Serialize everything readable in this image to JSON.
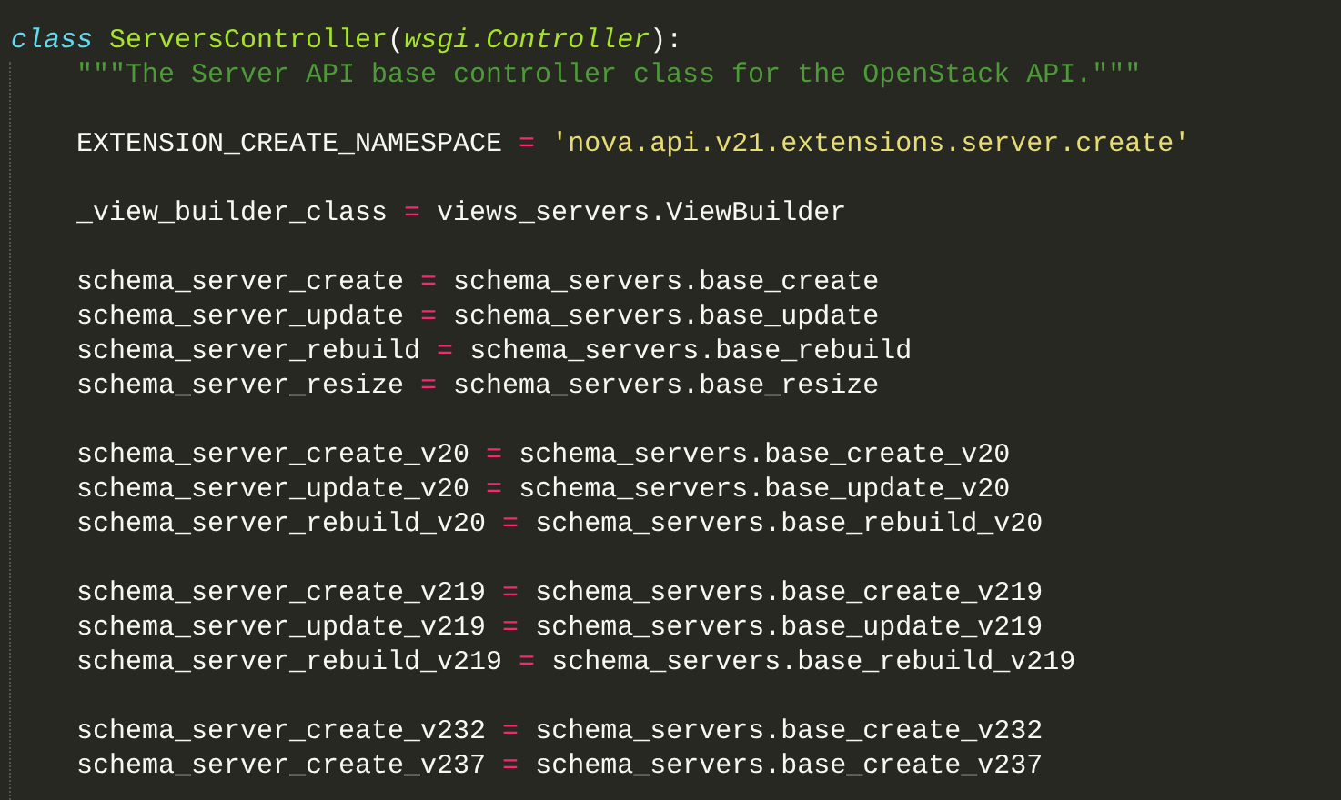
{
  "editor": {
    "class_line": [
      {
        "kind": "keyword",
        "text": "class"
      },
      {
        "kind": "name",
        "text": " ServersController"
      },
      {
        "kind": "plain",
        "text": "("
      },
      {
        "kind": "base",
        "text": "wsgi.Controller"
      },
      {
        "kind": "plain",
        "text": "):"
      }
    ],
    "body_blocks": [
      [
        [
          {
            "kind": "docstring",
            "text": "\"\"\"The Server API base controller class for the OpenStack API.\"\"\""
          }
        ]
      ],
      [
        [
          {
            "kind": "plain",
            "text": "EXTENSION_CREATE_NAMESPACE "
          },
          {
            "kind": "operator",
            "text": "="
          },
          {
            "kind": "string",
            "text": " 'nova.api.v21.extensions.server.create'"
          }
        ]
      ],
      [
        [
          {
            "kind": "plain",
            "text": "_view_builder_class "
          },
          {
            "kind": "operator",
            "text": "="
          },
          {
            "kind": "plain",
            "text": " views_servers.ViewBuilder"
          }
        ]
      ],
      [
        [
          {
            "kind": "plain",
            "text": "schema_server_create "
          },
          {
            "kind": "operator",
            "text": "="
          },
          {
            "kind": "plain",
            "text": " schema_servers.base_create"
          }
        ],
        [
          {
            "kind": "plain",
            "text": "schema_server_update "
          },
          {
            "kind": "operator",
            "text": "="
          },
          {
            "kind": "plain",
            "text": " schema_servers.base_update"
          }
        ],
        [
          {
            "kind": "plain",
            "text": "schema_server_rebuild "
          },
          {
            "kind": "operator",
            "text": "="
          },
          {
            "kind": "plain",
            "text": " schema_servers.base_rebuild"
          }
        ],
        [
          {
            "kind": "plain",
            "text": "schema_server_resize "
          },
          {
            "kind": "operator",
            "text": "="
          },
          {
            "kind": "plain",
            "text": " schema_servers.base_resize"
          }
        ]
      ],
      [
        [
          {
            "kind": "plain",
            "text": "schema_server_create_v20 "
          },
          {
            "kind": "operator",
            "text": "="
          },
          {
            "kind": "plain",
            "text": " schema_servers.base_create_v20"
          }
        ],
        [
          {
            "kind": "plain",
            "text": "schema_server_update_v20 "
          },
          {
            "kind": "operator",
            "text": "="
          },
          {
            "kind": "plain",
            "text": " schema_servers.base_update_v20"
          }
        ],
        [
          {
            "kind": "plain",
            "text": "schema_server_rebuild_v20 "
          },
          {
            "kind": "operator",
            "text": "="
          },
          {
            "kind": "plain",
            "text": " schema_servers.base_rebuild_v20"
          }
        ]
      ],
      [
        [
          {
            "kind": "plain",
            "text": "schema_server_create_v219 "
          },
          {
            "kind": "operator",
            "text": "="
          },
          {
            "kind": "plain",
            "text": " schema_servers.base_create_v219"
          }
        ],
        [
          {
            "kind": "plain",
            "text": "schema_server_update_v219 "
          },
          {
            "kind": "operator",
            "text": "="
          },
          {
            "kind": "plain",
            "text": " schema_servers.base_update_v219"
          }
        ],
        [
          {
            "kind": "plain",
            "text": "schema_server_rebuild_v219 "
          },
          {
            "kind": "operator",
            "text": "="
          },
          {
            "kind": "plain",
            "text": " schema_servers.base_rebuild_v219"
          }
        ]
      ],
      [
        [
          {
            "kind": "plain",
            "text": "schema_server_create_v232 "
          },
          {
            "kind": "operator",
            "text": "="
          },
          {
            "kind": "plain",
            "text": " schema_servers.base_create_v232"
          }
        ],
        [
          {
            "kind": "plain",
            "text": "schema_server_create_v237 "
          },
          {
            "kind": "operator",
            "text": "="
          },
          {
            "kind": "plain",
            "text": " schema_servers.base_create_v237"
          }
        ]
      ]
    ]
  }
}
